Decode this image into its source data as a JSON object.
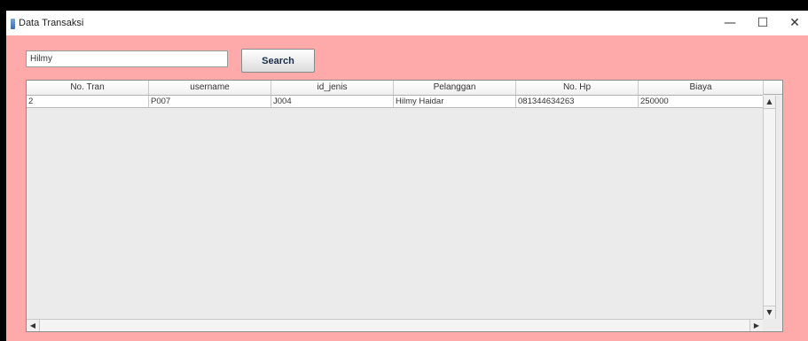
{
  "window": {
    "title": "Data Transaksi",
    "minimize_glyph": "—",
    "maximize_glyph": "☐",
    "close_glyph": "✕"
  },
  "search": {
    "value": "Hilmy",
    "button_label": "Search"
  },
  "table": {
    "columns": [
      "No. Tran",
      "username",
      "id_jenis",
      "Pelanggan",
      "No. Hp",
      "Biaya"
    ],
    "rows": [
      [
        "2",
        "P007",
        "J004",
        "Hilmy Haidar",
        "081344634263",
        "250000"
      ]
    ]
  },
  "colors": {
    "background": "#ffaaaa",
    "table_background": "#ebebeb"
  }
}
